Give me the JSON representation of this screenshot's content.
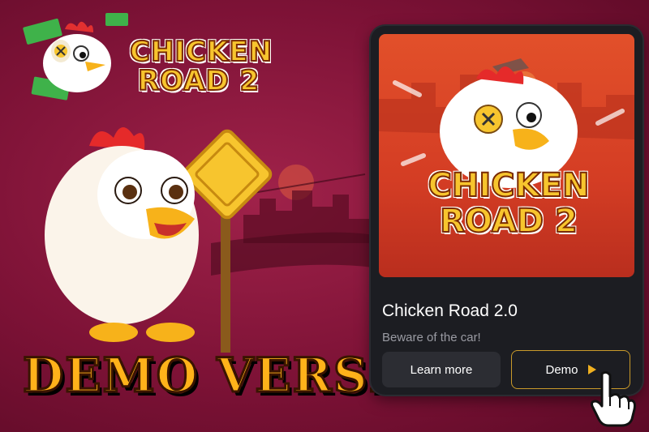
{
  "logo": {
    "line1": "CHICKEN",
    "line2": "ROAD 2"
  },
  "banner": {
    "text": "DEMO VERSION"
  },
  "card": {
    "image_logo_line1": "CHICKEN",
    "image_logo_line2": "ROAD 2",
    "title": "Chicken Road 2.0",
    "subtitle": "Beware of the car!",
    "learn_more_label": "Learn more",
    "demo_label": "Demo"
  },
  "colors": {
    "background": "#8a163c",
    "card": "#1c1d22",
    "accent_gold": "#f0b020",
    "text_muted": "#9a9ba3"
  },
  "icons": {
    "demo_button": "play-icon",
    "cursor": "hand-pointer-icon"
  }
}
